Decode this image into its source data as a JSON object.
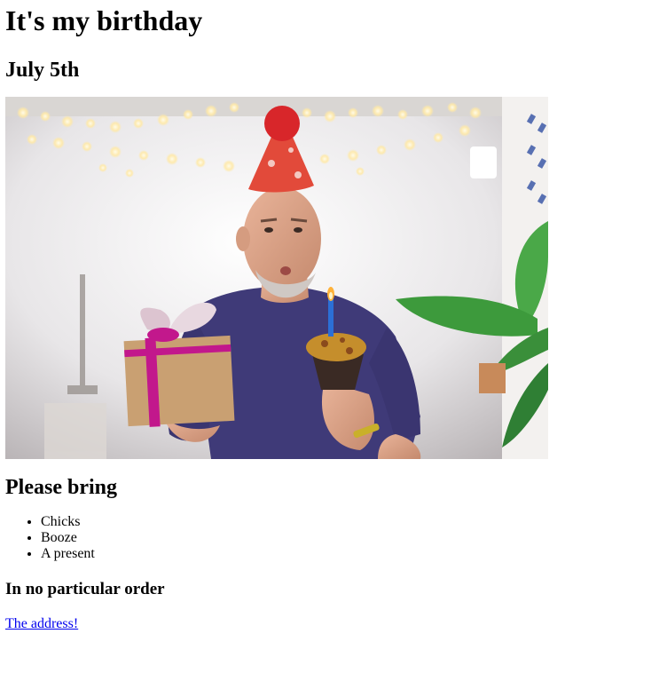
{
  "page": {
    "title": "It's my birthday",
    "date": "July 5th",
    "bring_heading": "Please bring",
    "bring_items": [
      "Chicks",
      "Booze",
      "A present"
    ],
    "order_note": "In no particular order",
    "address_link": "The address!"
  },
  "colors": {
    "link": "#0000ee",
    "shirt": "#3f3a78",
    "party_hat": "#e24a3a",
    "gift_box": "#c9a072",
    "gift_ribbon": "#c2188c",
    "candle": "#2b6fd6",
    "plant": "#3d9a3c"
  },
  "image": {
    "subject": "man-with-party-hat-blowing-candle-on-cupcake-holding-gift-icon"
  }
}
